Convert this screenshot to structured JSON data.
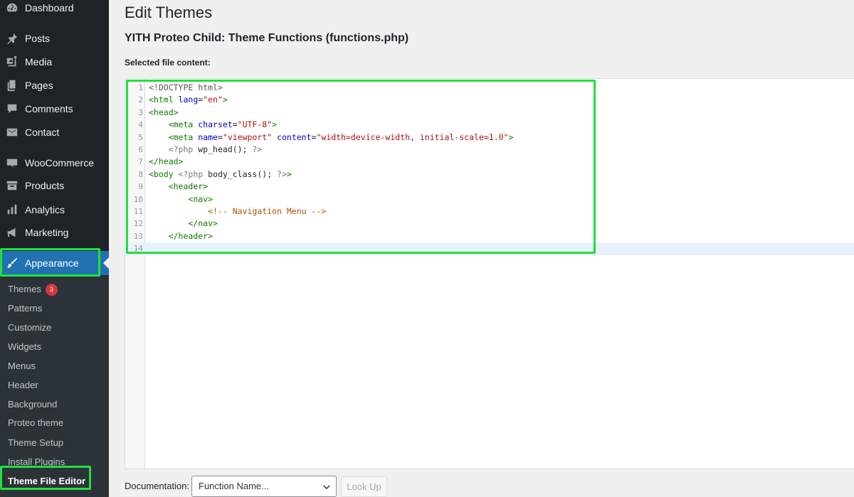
{
  "sidebar": {
    "items": [
      {
        "label": "Dashboard",
        "icon": "dashboard-icon"
      },
      {
        "label": "Posts",
        "icon": "pin-icon"
      },
      {
        "label": "Media",
        "icon": "media-icon"
      },
      {
        "label": "Pages",
        "icon": "pages-icon"
      },
      {
        "label": "Comments",
        "icon": "comment-icon"
      },
      {
        "label": "Contact",
        "icon": "mail-icon"
      },
      {
        "label": "WooCommerce",
        "icon": "woo-icon"
      },
      {
        "label": "Products",
        "icon": "archive-icon"
      },
      {
        "label": "Analytics",
        "icon": "bar-chart-icon"
      },
      {
        "label": "Marketing",
        "icon": "megaphone-icon"
      },
      {
        "label": "Appearance",
        "icon": "brush-icon",
        "active": true
      }
    ],
    "submenu": [
      {
        "label": "Themes",
        "badge": "3"
      },
      {
        "label": "Patterns"
      },
      {
        "label": "Customize"
      },
      {
        "label": "Widgets"
      },
      {
        "label": "Menus"
      },
      {
        "label": "Header"
      },
      {
        "label": "Background"
      },
      {
        "label": "Proteo theme"
      },
      {
        "label": "Theme Setup"
      },
      {
        "label": "Install Plugins"
      },
      {
        "label": "Theme File Editor",
        "current": true
      }
    ]
  },
  "main": {
    "page_title": "Edit Themes",
    "file_title": "YITH Proteo Child: Theme Functions (functions.php)",
    "file_label": "Selected file content:"
  },
  "editor": {
    "lines": [
      {
        "n": "1",
        "text": "<!DOCTYPE html>"
      },
      {
        "n": "2",
        "text": "<html lang=\"en\">"
      },
      {
        "n": "3",
        "text": "<head>"
      },
      {
        "n": "4",
        "text": "    <meta charset=\"UTF-8\">"
      },
      {
        "n": "5",
        "text": "    <meta name=\"viewport\" content=\"width=device-width, initial-scale=1.0\">"
      },
      {
        "n": "6",
        "text": "    <?php wp_head(); ?>"
      },
      {
        "n": "7",
        "text": "</head>"
      },
      {
        "n": "8",
        "text": "<body <?php body_class(); ?>>"
      },
      {
        "n": "9",
        "text": "    <header>"
      },
      {
        "n": "10",
        "text": "        <nav>"
      },
      {
        "n": "11",
        "text": "            <!-- Navigation Menu -->"
      },
      {
        "n": "12",
        "text": "        </nav>"
      },
      {
        "n": "13",
        "text": "    </header>"
      },
      {
        "n": "14",
        "text": ""
      }
    ]
  },
  "documentation": {
    "label": "Documentation:",
    "select_value": "Function Name...",
    "lookup_label": "Look Up"
  },
  "colors": {
    "sidebar_bg": "#1d2327",
    "submenu_bg": "#2c3338",
    "active": "#2271b1",
    "highlight": "#22e03c",
    "badge": "#d63638"
  }
}
